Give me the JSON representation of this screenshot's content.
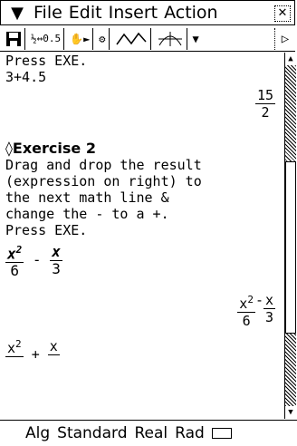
{
  "menubar": {
    "menu_icon": "▼",
    "items": [
      "File",
      "Edit",
      "Insert",
      "Action"
    ],
    "close_icon": "close-icon"
  },
  "toolbar": {
    "buttons": [
      "save-icon",
      "fraction-decimal-icon",
      "stylus-icon",
      "format-icon",
      "graph-icon",
      "dropdown-icon"
    ],
    "fraction_decimal_label": "½↔0.5",
    "scroll_right_icon": "▷"
  },
  "content": {
    "line1": "Press EXE.",
    "line2": "3+4.5",
    "result1": {
      "num": "15",
      "den": "2"
    },
    "exercise_title": "◊Exercise 2",
    "instructions": [
      "Drag and drop the result",
      "(expression on right) to",
      "the next math line &",
      "change the - to a +.",
      "Press EXE."
    ],
    "expr_left": {
      "a_num": "x",
      "a_exp": "2",
      "a_den": "6",
      "op": "-",
      "b_num": "x",
      "b_den": "3"
    },
    "expr_right": {
      "a_num": "x",
      "a_exp": "2",
      "a_den": "6",
      "op": "-",
      "b_num": "x",
      "b_den": "3"
    },
    "expr_next": {
      "a_num": "x",
      "a_exp": "2",
      "op": "+",
      "b_num": "x"
    }
  },
  "statusbar": {
    "items": [
      "Alg",
      "Standard",
      "Real",
      "Rad"
    ],
    "battery_icon": "battery-icon"
  }
}
